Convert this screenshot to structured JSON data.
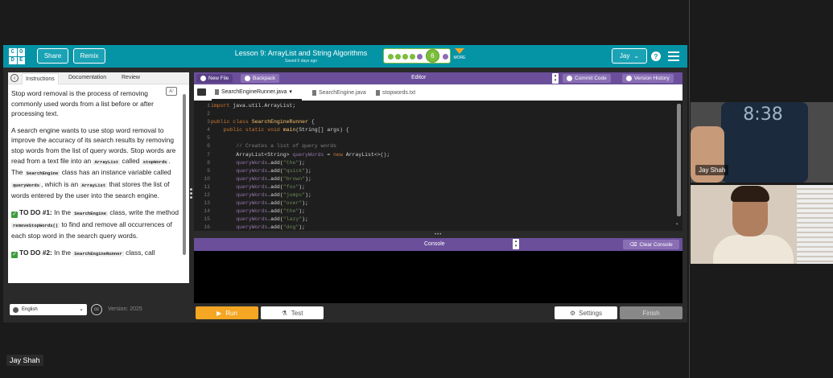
{
  "topbar": {
    "logo": [
      "C",
      "O",
      "D",
      "E"
    ],
    "share_label": "Share",
    "remix_label": "Remix",
    "lesson_title": "Lesson 9: ArrayList and String Algorithms",
    "saved": "Saved 6 days ago",
    "progress_current": "6",
    "more_label": "MORE",
    "user": "Jay",
    "help": "?"
  },
  "instructions": {
    "tabs": [
      "Instructions",
      "Documentation",
      "Review"
    ],
    "p1": "Stop word removal is the process of removing commonly used words from a list before or after processing text.",
    "p2_a": "A search engine wants to use stop word removal to improve the accuracy of its search results by removing stop words from the list of query words. Stop words are read from a text file into an ",
    "p2_code1": "ArrayList",
    "p2_b": " called ",
    "p2_code2": "stopWords",
    "p2_c": ". The ",
    "p2_code3": "SearchEngine",
    "p2_d": " class has an instance variable called ",
    "p2_code4": "queryWords",
    "p2_e": ", which is an ",
    "p2_code5": "ArrayList",
    "p2_f": " that stores the list of words entered by the user into the search engine.",
    "todo1_title": "TO DO #1:",
    "todo1_a": " In the ",
    "todo1_code1": "SearchEngine",
    "todo1_b": " class, write the method ",
    "todo1_code2": "removeStopWords()",
    "todo1_c": " to find and remove all occurrences of each stop word in the search query words.",
    "todo2_title": "TO DO #2:",
    "todo2_a": " In the ",
    "todo2_code1": "SearchEngineRunner",
    "todo2_b": " class, call"
  },
  "footer": {
    "language": "English",
    "version": "Version: 2025"
  },
  "editor": {
    "new_file": "New File",
    "backpack": "Backpack",
    "label": "Editor",
    "commit": "Commit Code",
    "history": "Version History",
    "tabs": [
      "SearchEngineRunner.java",
      "SearchEngine.java",
      "stopwords.txt"
    ],
    "line_numbers": [
      "1",
      "2",
      "3",
      "4",
      "5",
      "6",
      "7",
      "8",
      "9",
      "10",
      "11",
      "12",
      "13",
      "14",
      "15",
      "16"
    ]
  },
  "console": {
    "label": "Console",
    "clear": "Clear Console"
  },
  "actions": {
    "run": "Run",
    "test": "Test",
    "settings": "Settings",
    "finish": "Finish"
  },
  "video": {
    "tile1_name": "Jay Shah",
    "tile1_clock": "8:38",
    "main_name": "Jay Shah"
  },
  "colors": {
    "teal": "#0594a6",
    "purple": "#6b4f9b",
    "orange": "#f5a623",
    "green": "#7cbd3c"
  }
}
